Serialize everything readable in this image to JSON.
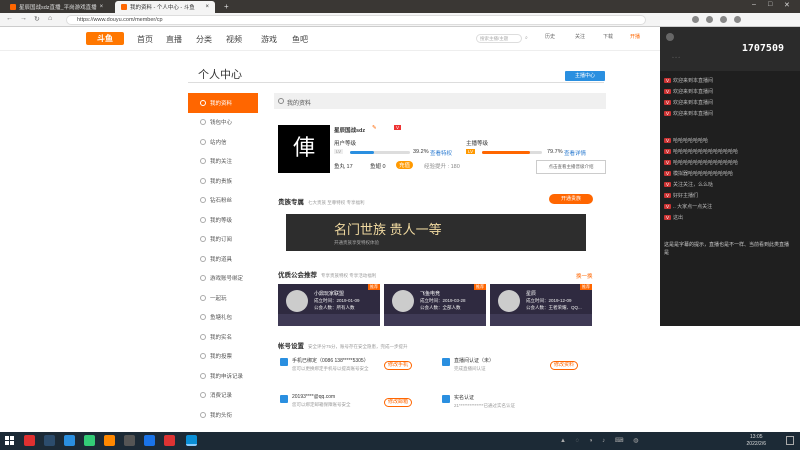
{
  "browser": {
    "tabs": [
      {
        "title": "星辰国战sdz直播_平岗游戏直播"
      },
      {
        "title": "我的资料 - 个人中心 - 斗鱼"
      }
    ],
    "url": "https://www.douyu.com/member/cp"
  },
  "header": {
    "logo": "斗鱼",
    "nav": [
      "首页",
      "直播",
      "分类",
      "视频",
      "游戏",
      "鱼吧"
    ],
    "search_placeholder": "搜索主播/主题",
    "icons": [
      "历史",
      "关注",
      "下载",
      "开播"
    ]
  },
  "live_panel": {
    "viewer_count": "1707509",
    "messages": [
      "欢迎来到本直播间",
      "欢迎来到本直播间",
      "欢迎来到本直播间",
      "欢迎来到本直播间",
      "哈哈哈哈哈哈哈",
      "哈哈哈哈哈哈哈哈哈哈哈哈哈",
      "哈哈哈哈哈哈哈哈哈哈哈哈哈",
      "模拟器哈哈哈哈哈哈哈哈哈",
      "关注关注，么么哒",
      "好好主播们 ",
      ".. 大家点一点关注",
      "这出"
    ],
    "ad": "这是是字幕的提示，直播也是不一样、当前看到此类直播 是"
  },
  "page": {
    "title": "个人中心",
    "host_button": "主播中心",
    "sidebar": [
      "我的资料",
      "钱包中心",
      "站内信",
      "我的关注",
      "我的贵族",
      "钻石粉丝",
      "我的等级",
      "我的订阅",
      "我的道具",
      "游戏账号绑定",
      "一起玩",
      "鱼塘礼包",
      "我的实名",
      "我的投票",
      "我的申诉记录",
      "消费记录",
      "我的头衔"
    ],
    "section": "我的资料",
    "profile": {
      "name": "星辰国战sdz",
      "user_level_label": "用户等级",
      "user_level_pct": "39.2%",
      "user_level_link": "查看特权",
      "host_level_label": "主播等级",
      "host_level_pct": "79.7%",
      "host_level_link": "查看详情",
      "fish_ball": "鱼丸 17",
      "fish_fin": "鱼翅 0",
      "recharge": "充值",
      "exp_label": "经验提升 : 180",
      "tooltip": "点击查看主播晋级介绍"
    },
    "noble": {
      "title": "贵族专属",
      "note": "七大贵族 至尊特权 专享福利",
      "button": "开通贵族",
      "banner_title": "名门世族 贵人一等",
      "banner_sub": "开通贵族享受特权体验"
    },
    "guilds": {
      "title": "优质公会推荐",
      "note": "专享贵族特权 专享活动福利",
      "more": "换一换",
      "cards": [
        {
          "name": "小鼎玩家联盟",
          "date": "成立时间：2019-01-09",
          "info": "公会人数：所有人数",
          "tag": "推荐"
        },
        {
          "name": "飞鱼电竞",
          "date": "成立时间：2019-03-28",
          "info": "公会人数：全部人数",
          "tag": "推荐"
        },
        {
          "name": "星辰",
          "date": "成立时间：2019-12-09",
          "info": "公会人数：王者荣耀、QQ...",
          "tag": "推荐"
        }
      ]
    },
    "account": {
      "title": "帐号设置",
      "note": "安全评分75分，账号存在安全隐患，完成一步提升",
      "phone": {
        "label": "手机已绑定（0086 138*****5305）",
        "desc": "您可以更换绑定手机号以提高账号安全",
        "btn": "修改手机"
      },
      "real": {
        "label": "直播间认证（未）",
        "desc": "完成直播间认证",
        "btn": "修改资料"
      },
      "email": {
        "label": "20193****@qq.com",
        "desc": "您可以绑定邮箱保障账号安全",
        "btn": "修改邮箱"
      },
      "id": {
        "label": "实名认证",
        "desc": "21**************已通过实名认证"
      }
    }
  },
  "taskbar": {
    "time": "13:05",
    "date": "2022/2/6"
  }
}
